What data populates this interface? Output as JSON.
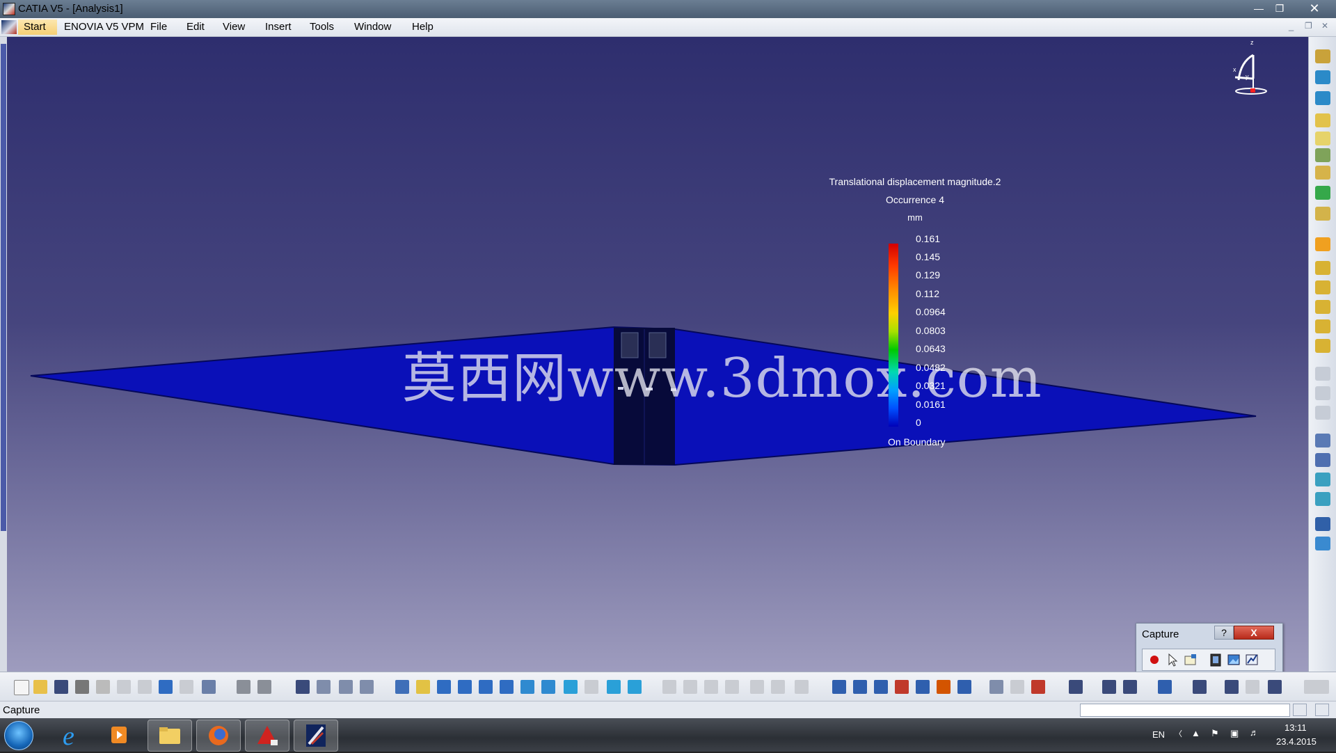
{
  "titlebar": {
    "title": "CATIA V5 - [Analysis1]"
  },
  "menubar": {
    "start": "Start",
    "items": [
      "ENOVIA V5 VPM",
      "File",
      "Edit",
      "View",
      "Insert",
      "Tools",
      "Window",
      "Help"
    ]
  },
  "viewport": {
    "watermark": "莫西网www.3dmox.com",
    "compass_axes": {
      "x": "x",
      "y": "y",
      "z": "z"
    }
  },
  "legend": {
    "title": "Translational displacement magnitude.2",
    "occurrence": "Occurrence 4",
    "unit": "mm",
    "values": [
      "0.161",
      "0.145",
      "0.129",
      "0.112",
      "0.0964",
      "0.0803",
      "0.0643",
      "0.0482",
      "0.0321",
      "0.0161",
      "0"
    ],
    "footer": "On Boundary"
  },
  "capture": {
    "title": "Capture",
    "help": "?",
    "close": "X"
  },
  "statusbar": {
    "text": "Capture"
  },
  "taskbar": {
    "language": "EN",
    "time": "13:11",
    "date": "23.4.2015"
  }
}
